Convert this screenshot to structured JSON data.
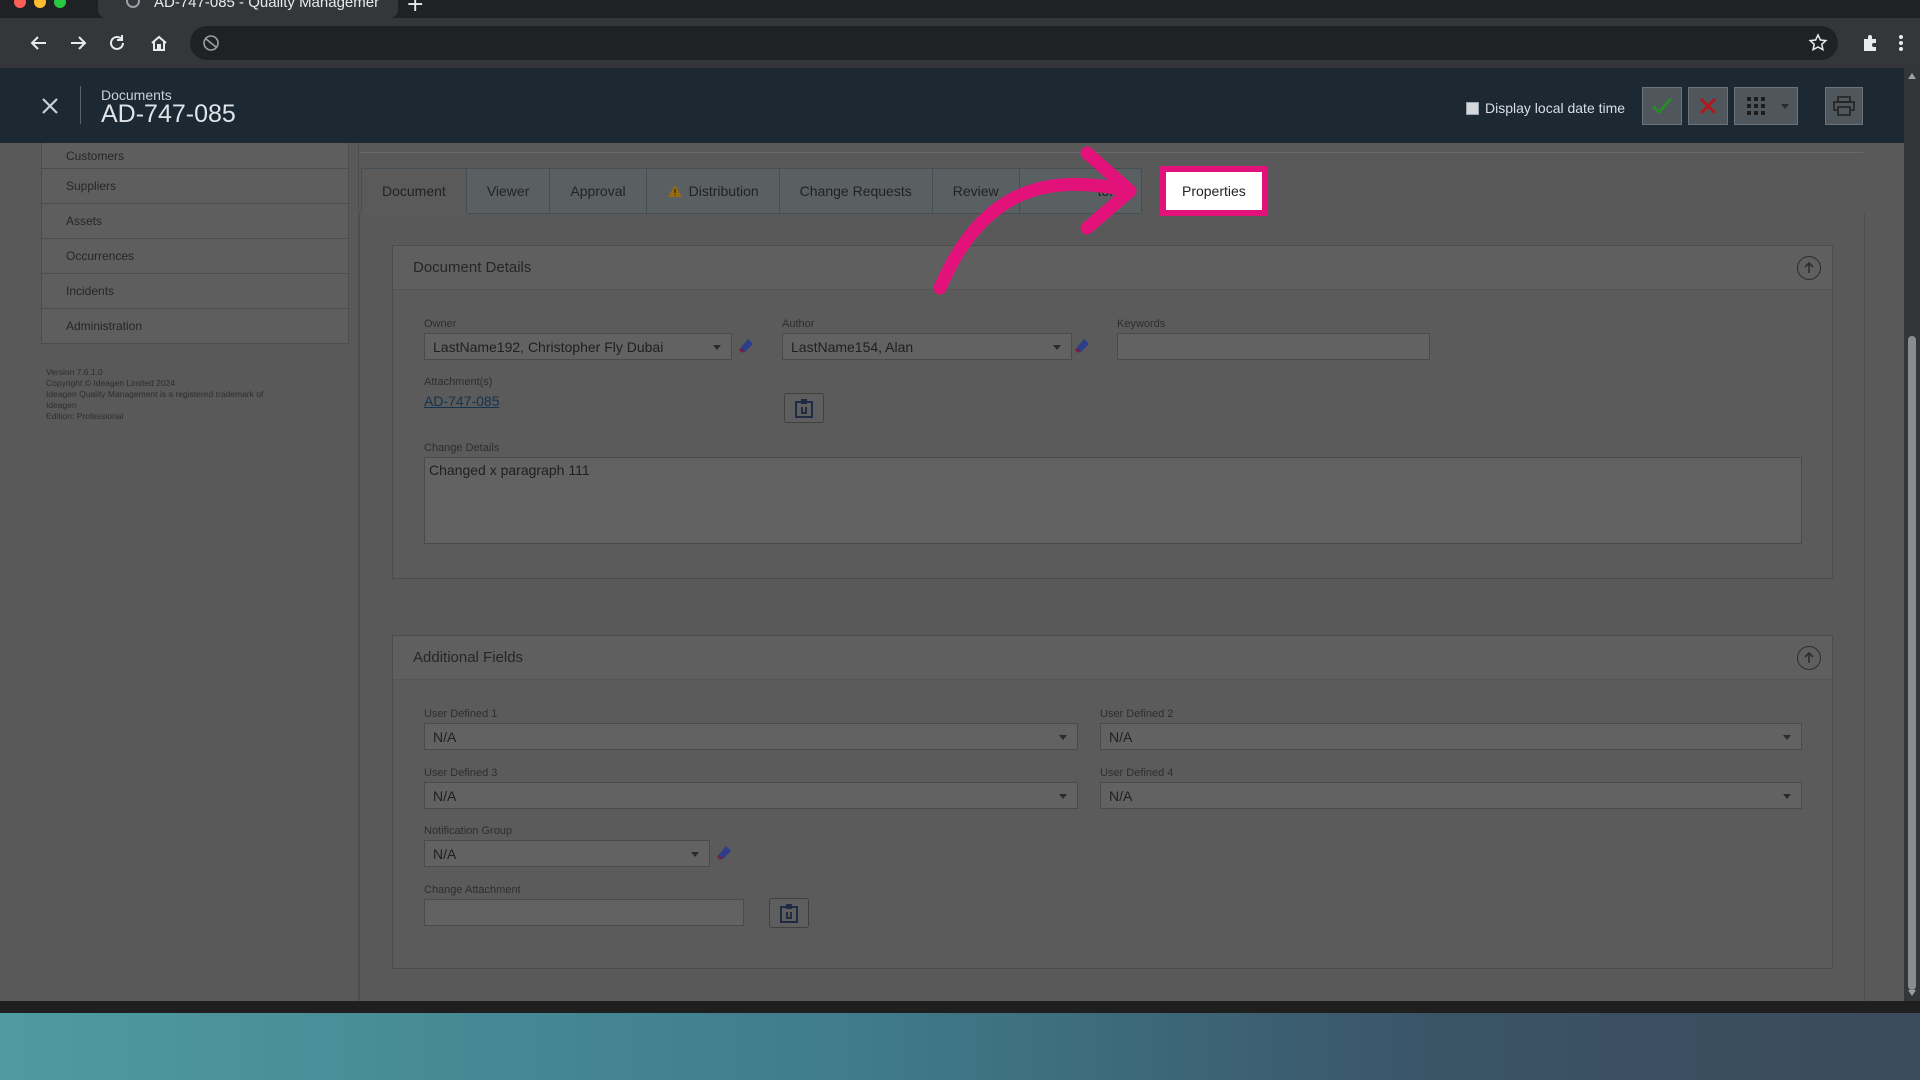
{
  "browser": {
    "tab_title": "AD-747-085 - Quality Managemer",
    "new_tab": "+",
    "colors": {
      "close": "#ff5f57",
      "minimize": "#febc2e",
      "maximize": "#28c840"
    }
  },
  "header": {
    "breadcrumb": "Documents",
    "doc_id": "AD-747-085",
    "display_local_date_time": "Display local date time",
    "icons": [
      "close-icon",
      "checkmark-icon",
      "cancel-icon",
      "grid-menu-icon",
      "print-icon"
    ]
  },
  "sidebar": {
    "items": [
      {
        "label": "Customers"
      },
      {
        "label": "Suppliers"
      },
      {
        "label": "Assets"
      },
      {
        "label": "Occurrences"
      },
      {
        "label": "Incidents"
      },
      {
        "label": "Administration"
      }
    ],
    "footer": [
      "Version 7.6.1.0",
      "Copyright © Ideagen Limited 2024",
      "Ideagen Quality Management is a registered trademark of",
      "Ideagen",
      "Edition: Professional"
    ]
  },
  "tabs": [
    {
      "label": "Document"
    },
    {
      "label": "Viewer"
    },
    {
      "label": "Approval"
    },
    {
      "label": "Distribution",
      "icon": "warning-icon"
    },
    {
      "label": "Change Requests"
    },
    {
      "label": "Review"
    },
    {
      "label": "tory"
    },
    {
      "label": "Properties",
      "highlighted": true
    }
  ],
  "document_details": {
    "title": "Document Details",
    "owner_label": "Owner",
    "owner_value": "LastName192, Christopher Fly Dubai",
    "author_label": "Author",
    "author_value": "LastName154, Alan",
    "keywords_label": "Keywords",
    "keywords_value": "",
    "attachments_label": "Attachment(s)",
    "attachment_link": "AD-747-085",
    "change_details_label": "Change Details",
    "change_details_value": "Changed x paragraph 111"
  },
  "additional_fields": {
    "title": "Additional Fields",
    "ud1_label": "User Defined 1",
    "ud1_value": "N/A",
    "ud2_label": "User Defined 2",
    "ud2_value": "N/A",
    "ud3_label": "User Defined 3",
    "ud3_value": "N/A",
    "ud4_label": "User Defined 4",
    "ud4_value": "N/A",
    "notification_group_label": "Notification Group",
    "notification_group_value": "N/A",
    "change_attachment_label": "Change Attachment",
    "change_attachment_value": ""
  },
  "annotation": {
    "highlight_color": "#e2127a",
    "arrow_color": "#e2127a"
  }
}
